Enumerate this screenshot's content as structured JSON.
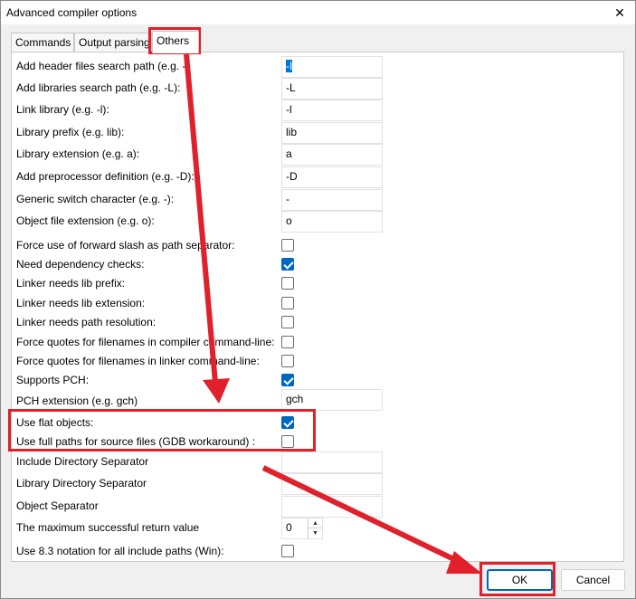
{
  "window": {
    "title": "Advanced compiler options",
    "close_glyph": "✕"
  },
  "tabs": [
    {
      "label": "Commands",
      "active": false
    },
    {
      "label": "Output parsing",
      "active": false
    },
    {
      "label": "Others",
      "active": true
    }
  ],
  "rows": {
    "header_search": {
      "label": "Add header files search path (e.g. -",
      "value": "-I"
    },
    "lib_search": {
      "label": "Add libraries search path (e.g. -L):",
      "value": "-L"
    },
    "link_lib": {
      "label": "Link library (e.g. -l):",
      "value": "-l"
    },
    "lib_prefix": {
      "label": "Library prefix (e.g. lib):",
      "value": "lib"
    },
    "lib_ext": {
      "label": "Library extension (e.g. a):",
      "value": "a"
    },
    "preproc_def": {
      "label": "Add preprocessor definition (e.g. -D):",
      "value": "-D"
    },
    "switch_char": {
      "label": "Generic switch character (e.g. -):",
      "value": "-"
    },
    "obj_ext": {
      "label": "Object file extension (e.g. o):",
      "value": "o"
    },
    "fwd_slash": {
      "label": "Force use of forward slash as path separator:",
      "checked": false
    },
    "dep_checks": {
      "label": "Need dependency checks:",
      "checked": true
    },
    "lib_prefix_needed": {
      "label": "Linker needs lib prefix:",
      "checked": false
    },
    "lib_ext_needed": {
      "label": "Linker needs lib extension:",
      "checked": false
    },
    "path_resolution": {
      "label": "Linker needs path resolution:",
      "checked": false
    },
    "quotes_compiler": {
      "label": "Force quotes for filenames in compiler command-line:",
      "checked": false
    },
    "quotes_linker": {
      "label": "Force quotes for filenames in linker command-line:",
      "checked": false
    },
    "supports_pch": {
      "label": "Supports PCH:",
      "checked": true
    },
    "pch_ext": {
      "label": "PCH extension (e.g. gch)",
      "value": "gch"
    },
    "flat_objects": {
      "label": "Use flat objects:",
      "checked": true
    },
    "full_paths": {
      "label": "Use full paths for source files (GDB workaround) :",
      "checked": false
    },
    "include_sep": {
      "label": "Include Directory Separator",
      "value": ""
    },
    "library_sep": {
      "label": "Library Directory Separator",
      "value": ""
    },
    "object_sep": {
      "label": "Object Separator",
      "value": ""
    },
    "max_return": {
      "label": "The maximum successful return value",
      "value": "0"
    },
    "notation_83": {
      "label": "Use 8.3 notation for all include paths (Win):",
      "checked": false
    }
  },
  "buttons": {
    "ok": "OK",
    "cancel": "Cancel"
  },
  "colors": {
    "accent": "#0067c0",
    "annotation": "#e0202a"
  }
}
